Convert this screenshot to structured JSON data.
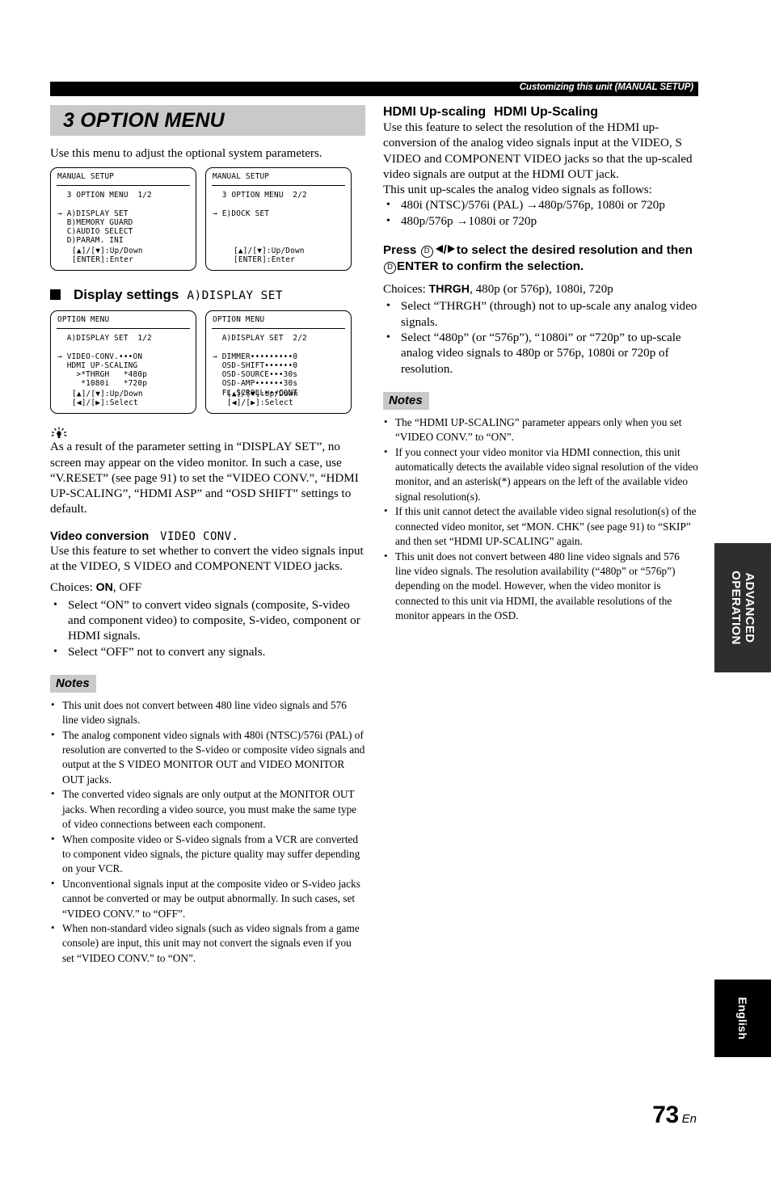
{
  "header": {
    "running_head": "Customizing this unit (MANUAL SETUP)"
  },
  "left_column": {
    "chapter_title": "3 OPTION MENU",
    "intro": "Use this menu to adjust the optional system parameters.",
    "lcd_manual_setup_1": {
      "title": "MANUAL SETUP",
      "body": "  3 OPTION MENU  1/2\n\n→ A)DISPLAY SET\n  B)MEMORY GUARD\n  C)AUDIO SELECT\n  D)PARAM. INI",
      "footer": "[▲]/[▼]:Up/Down\n[ENTER]:Enter"
    },
    "lcd_manual_setup_2": {
      "title": "MANUAL SETUP",
      "body": "  3 OPTION MENU  2/2\n\n→ E)DOCK SET",
      "footer": "[▲]/[▼]:Up/Down\n[ENTER]:Enter"
    },
    "display_settings_heading": {
      "label": "Display settings",
      "lcd_label": "A)DISPLAY SET"
    },
    "lcd_option_menu_1": {
      "title": "OPTION MENU",
      "body": "  A)DISPLAY SET  1/2\n\n→ VIDEO-CONV.•••ON\n  HDMI UP-SCALING\n    >*THRGH   *480p\n     *1080i   *720p",
      "footer": "[▲]/[▼]:Up/Down\n[◀]/[▶]:Select"
    },
    "lcd_option_menu_2": {
      "title": "OPTION MENU",
      "body": "  A)DISPLAY SET  2/2\n\n→ DIMMER•••••••••0\n  OSD-SHIFT••••••0\n  OSD-SOURCE•••30s\n  OSD-AMP••••••30s\n  FL SCROLL•••CONT",
      "footer": "[▲]/[▼]:Up/Down\n[◀]/[▶]:Select"
    },
    "tip_text": "As a result of the parameter setting in “DISPLAY SET”, no screen may appear on the video monitor. In such a case, use “V.RESET” (see page 91) to set the “VIDEO CONV.”, “HDMI UP-SCALING”, “HDMI ASP” and “OSD SHIFT” settings to default.",
    "video_conversion": {
      "heading": "Video conversion",
      "heading_lcd": "VIDEO CONV.",
      "description": "Use this feature to set whether to convert the video signals input at the VIDEO, S VIDEO and COMPONENT VIDEO jacks.",
      "choices_prefix": "Choices: ",
      "choices_bold": "ON",
      "choices_rest": ", OFF",
      "bullets": [
        "Select “ON” to convert video signals (composite, S-video and component video) to composite, S-video, component or HDMI signals.",
        "Select “OFF” not to convert any signals."
      ]
    },
    "notes_label": "Notes",
    "notes": [
      "This unit does not convert between 480 line video signals and 576 line video signals.",
      "The analog component video signals with 480i (NTSC)/576i (PAL) of resolution are converted to the S-video or composite video signals and output at the S VIDEO MONITOR OUT and VIDEO MONITOR OUT jacks.",
      "The converted video signals are only output at the MONITOR OUT jacks. When recording a video source, you must make the same type of video connections between each component.",
      "When composite video or S-video signals from a VCR are converted to component video signals, the picture quality may suffer depending on your VCR.",
      "Unconventional signals input at the composite video or S-video jacks cannot be converted or may be output abnormally. In such cases, set “VIDEO CONV.” to “OFF”.",
      "When non-standard video signals (such as video signals from a game console) are input, this unit may not convert the signals even if you set “VIDEO CONV.” to “ON”."
    ]
  },
  "right_column": {
    "hdmi_upscaling": {
      "heading": "HDMI Up-scaling",
      "heading_lcd": "HDMI Up-Scaling",
      "description": "Use this feature to select the resolution of the HDMI up-conversion of the analog video signals input at the VIDEO, S VIDEO and COMPONENT VIDEO jacks so that the up-scaled video signals are output at the HDMI OUT jack.",
      "follows_line": "This unit up-scales the analog video signals as follows:",
      "bullets": [
        "480i (NTSC)/576i (PAL) →480p/576p, 1080i or 720p",
        "480p/576p →1080i or 720p"
      ]
    },
    "press_instruction": {
      "press_word": "Press",
      "button_circle_1": "D",
      "mid_text": "to select the desired resolution and then",
      "button_circle_2": "D",
      "enter_word": "ENTER",
      "tail_text": "to confirm the selection."
    },
    "choices_prefix": "Choices: ",
    "choices_bold": "THRGH",
    "choices_rest": ", 480p (or 576p), 1080i, 720p",
    "choice_bullets": [
      "Select “THRGH” (through) not to up-scale any analog video signals.",
      "Select “480p” (or “576p”), “1080i” or “720p” to up-scale analog video signals to 480p or 576p, 1080i or 720p of resolution."
    ],
    "notes_label": "Notes",
    "notes": [
      "The “HDMI UP-SCALING” parameter appears only when you set “VIDEO CONV.” to “ON”.",
      "If you connect your video monitor via HDMI connection, this unit automatically detects the available video signal resolution of the video monitor, and an asterisk(*) appears on the left of the available video signal resolution(s).",
      "If this unit cannot detect the available video signal resolution(s) of the connected video monitor, set “MON. CHK” (see page 91) to “SKIP” and then set “HDMI UP-SCALING” again.",
      "This unit does not convert between 480 line video signals and 576 line video signals. The resolution availability (“480p” or “576p”) depending on the model. However, when the video monitor is connected to this unit via HDMI, the available resolutions of the monitor appears in the OSD."
    ]
  },
  "thumb_tabs": {
    "advanced": "ADVANCED\nOPERATION",
    "language": "English"
  },
  "folio": {
    "page_number": "73",
    "language_suffix": "En"
  },
  "colors": {
    "band_gray": "#c9c9c9",
    "header_black": "#000000",
    "tab_dark": "#2e2e2e"
  }
}
